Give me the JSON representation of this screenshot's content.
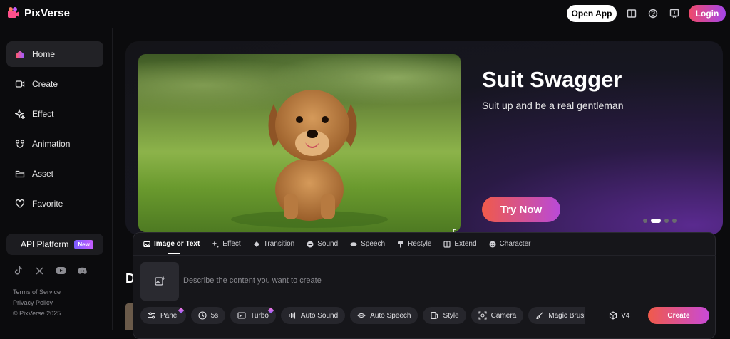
{
  "header": {
    "brand": "PixVerse",
    "open_app_label": "Open App",
    "login_label": "Login",
    "icons": [
      "book-icon",
      "help-icon",
      "feedback-icon"
    ]
  },
  "sidebar": {
    "items": [
      {
        "label": "Home",
        "icon": "home-icon",
        "active": true
      },
      {
        "label": "Create",
        "icon": "video-icon"
      },
      {
        "label": "Effect",
        "icon": "sparkle-icon"
      },
      {
        "label": "Animation",
        "icon": "mascot-icon"
      },
      {
        "label": "Asset",
        "icon": "folder-icon"
      },
      {
        "label": "Favorite",
        "icon": "heart-icon"
      }
    ],
    "api_platform_label": "API Platform",
    "api_badge": "New",
    "socials": [
      "tiktok-icon",
      "x-icon",
      "youtube-icon",
      "discord-icon"
    ],
    "footer": {
      "terms": "Terms of Service",
      "privacy": "Privacy Policy",
      "copyright": "© PixVerse 2025"
    }
  },
  "banner": {
    "title": "Suit Swagger",
    "subtitle": "Suit up and be a real gentleman",
    "cta_label": "Try Now",
    "slide_count": 4,
    "active_slide": 2
  },
  "section_peek": "D",
  "composer": {
    "tabs": [
      {
        "label": "Image or Text",
        "icon": "image-icon",
        "active": true
      },
      {
        "label": "Effect",
        "icon": "sparkle-icon"
      },
      {
        "label": "Transition",
        "icon": "transition-icon"
      },
      {
        "label": "Sound",
        "icon": "sound-icon"
      },
      {
        "label": "Speech",
        "icon": "speech-icon"
      },
      {
        "label": "Restyle",
        "icon": "restyle-icon"
      },
      {
        "label": "Extend",
        "icon": "extend-icon"
      },
      {
        "label": "Character",
        "icon": "character-icon"
      }
    ],
    "prompt_placeholder": "Describe the content you want to create",
    "chips": [
      {
        "label": "Panel",
        "icon": "sliders-icon",
        "premium": true
      },
      {
        "label": "5s",
        "icon": "clock-icon"
      },
      {
        "label": "Turbo",
        "icon": "turbo-icon",
        "premium": true
      },
      {
        "label": "Auto Sound",
        "icon": "waveform-icon"
      },
      {
        "label": "Auto Speech",
        "icon": "lips-icon"
      },
      {
        "label": "Style",
        "icon": "style-icon"
      },
      {
        "label": "Camera",
        "icon": "camera-icon"
      },
      {
        "label": "Magic Brus",
        "icon": "brush-icon"
      }
    ],
    "model_label": "V4",
    "create_label": "Create"
  },
  "colors": {
    "accent_start": "#f05a4a",
    "accent_end": "#c84ad8",
    "background": "#0b0b0d"
  }
}
